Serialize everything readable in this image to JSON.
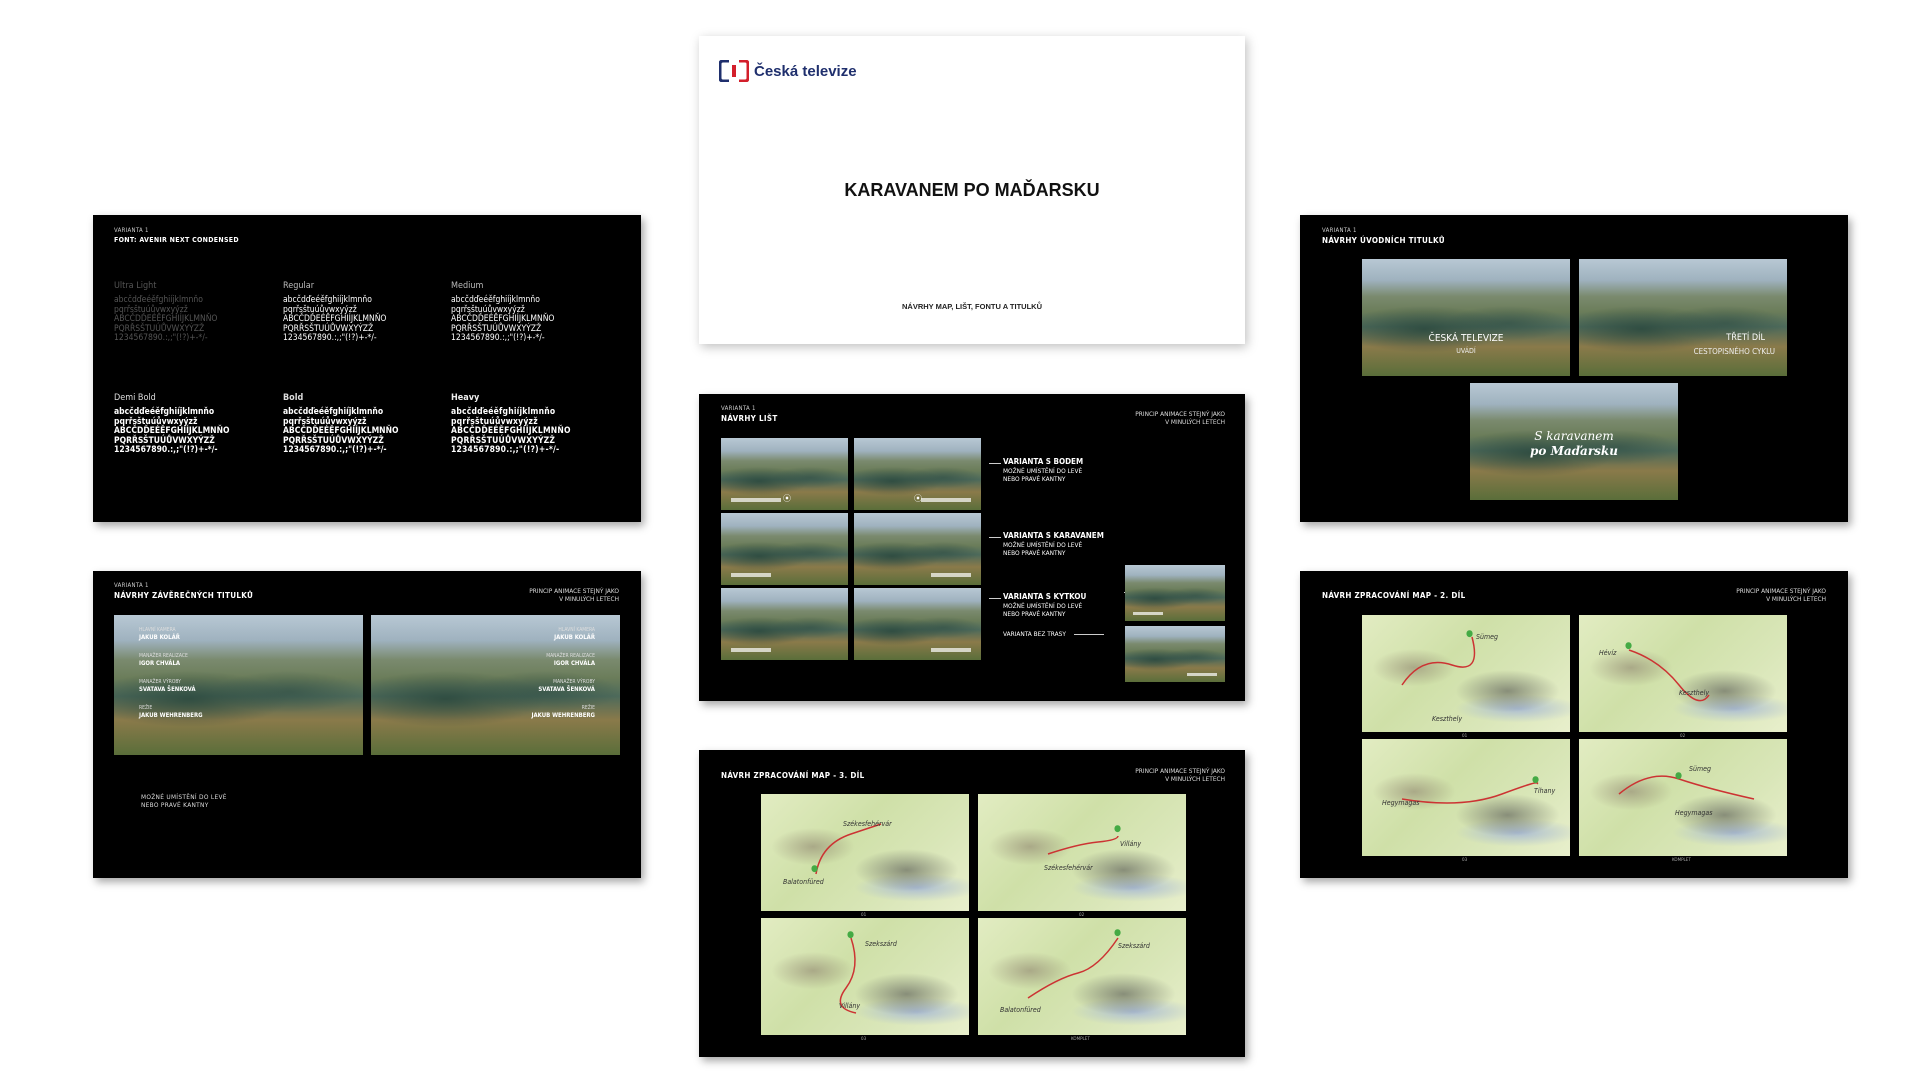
{
  "cover": {
    "logo_text": "Česká televize",
    "title": "KARAVANEM PO MAĎARSKU",
    "subtitle": "NÁVRHY MAP, LIŠT, FONTU A TITULKŮ"
  },
  "font_slide": {
    "variant": "VARIANTA 1",
    "title": "FONT: AVENIR NEXT CONDENSED",
    "weights": [
      {
        "name": "Ultra Light",
        "lines": [
          "abcčdďeéěfghiíjklmnňo",
          "pqrřsštuúůvwxyýzž",
          "ABCČDĎEÉĚFGHIÍJKLMNŇO",
          "PQRŘSŠTUÚŮVWXYÝZŽ",
          "1234567890.:,;\"(!?)+-*/-"
        ]
      },
      {
        "name": "Regular",
        "lines": [
          "abcčdďeéěfghiíjklmnňo",
          "pqrřsštuúůvwxyýzž",
          "ABCČDĎEÉĚFGHIÍJKLMNŇO",
          "PQRŘSŠTUÚŮVWXYÝZŽ",
          "1234567890.:,;\"(!?)+-*/-"
        ]
      },
      {
        "name": "Medium",
        "lines": [
          "abcčdďeéěfghiíjklmnňo",
          "pqrřsštuúůvwxyýzž",
          "ABCČDĎEÉĚFGHIÍJKLMNŇO",
          "PQRŘSŠTUÚŮVWXYÝZŽ",
          "1234567890.:,;\"(!?)+-*/-"
        ]
      },
      {
        "name": "Demi Bold",
        "lines": [
          "abcčdďeéěfghiíjklmnňo",
          "pqrřsštuúůvwxyýzž",
          "ABCČDĎEÉĚFGHIÍJKLMNŇO",
          "PQRŘSŠTUÚŮVWXYÝZŽ",
          "1234567890.:,;\"(!?)+-*/-"
        ]
      },
      {
        "name": "Bold",
        "lines": [
          "abcčdďeéěfghiíjklmnňo",
          "pqrřsštuúůvwxyýzž",
          "ABCČDĎEÉĚFGHIÍJKLMNŇO",
          "PQRŘSŠTUÚŮVWXYÝZŽ",
          "1234567890.:,;\"(!?)+-*/-"
        ]
      },
      {
        "name": "Heavy",
        "lines": [
          "abcčdďeéěfghiíjklmnňo",
          "pqrřsštuúůvwxyýzž",
          "ABCČDĎEÉĚFGHIÍJKLMNŇO",
          "PQRŘSŠTUÚŮVWXYÝZŽ",
          "1234567890.:,;\"(!?)+-*/-"
        ]
      }
    ]
  },
  "intro_titles": {
    "variant": "VARIANTA 1",
    "title": "NÁVRHY ÚVODNÍCH TITULKŮ",
    "card1_main": "ČESKÁ TELEVIZE",
    "card1_sub": "UVÁDÍ",
    "card2_main": "TŘETÍ DÍL",
    "card2_sub": "CESTOPISNÉHO CYKLU",
    "card3_line1": "S karavanem",
    "card3_line2": "po Maďarsku"
  },
  "listy": {
    "variant": "VARIANTA 1",
    "title": "NÁVRHY LIŠT",
    "note_line1": "PRINCIP ANIMACE STEJNÝ JAKO",
    "note_line2": "V MINULÝCH LETECH",
    "v1_title": "VARIANTA S BODEM",
    "v1_line1": "MOŽNÉ UMÍSTĚNÍ DO LEVÉ",
    "v1_line2": "NEBO PRAVÉ KANTNY",
    "v2_title": "VARIANTA S KARAVANEM",
    "v2_line1": "MOŽNÉ UMÍSTĚNÍ DO LEVÉ",
    "v2_line2": "NEBO PRAVÉ KANTNY",
    "v3_title": "VARIANTA S KYTKOU",
    "v3_line1": "MOŽNÉ UMÍSTĚNÍ DO LEVÉ",
    "v3_line2": "NEBO PRAVÉ KANTNY",
    "v4_title": "VARIANTA BEZ TRASY"
  },
  "end_titles": {
    "variant": "VARIANTA 1",
    "title": "NÁVRHY ZÁVĚREČNÝCH TITULKŮ",
    "note_line1": "PRINCIP ANIMACE STEJNÝ JAKO",
    "note_line2": "V MINULÝCH LETECH",
    "credits": [
      {
        "role": "HLAVNÍ KAMERA",
        "name": "JAKUB KOLÁŘ"
      },
      {
        "role": "MANAŽER REALIZACE",
        "name": "IGOR CHVÁLA"
      },
      {
        "role": "MANAŽER VÝROBY",
        "name": "SVATAVA ŠENKOVÁ"
      },
      {
        "role": "REŽIE",
        "name": "JAKUB WEHRENBERG"
      }
    ],
    "bottom_line1": "MOŽNÉ UMÍSTĚNÍ DO LEVÉ",
    "bottom_line2": "NEBO PRAVÉ KANTNY"
  },
  "maps3": {
    "title": "NÁVRH ZPRACOVÁNÍ MAP - 3. DÍL",
    "note_line1": "PRINCIP ANIMACE STEJNÝ JAKO",
    "note_line2": "V MINULÝCH LETECH",
    "captions": [
      "01",
      "02",
      "03",
      "KOMPLET"
    ],
    "places": [
      "Szekszárd",
      "Balatonfüred",
      "Villány",
      "Székesfehérvár"
    ]
  },
  "maps2": {
    "title": "NÁVRH ZPRACOVÁNÍ MAP - 2. DÍL",
    "note_line1": "PRINCIP ANIMACE STEJNÝ JAKO",
    "note_line2": "V MINULÝCH LETECH",
    "captions": [
      "01",
      "02",
      "03",
      "KOMPLET"
    ],
    "places": [
      "Sümeg",
      "Keszthely",
      "Hévíz",
      "Hegymagas",
      "Tihany"
    ]
  }
}
